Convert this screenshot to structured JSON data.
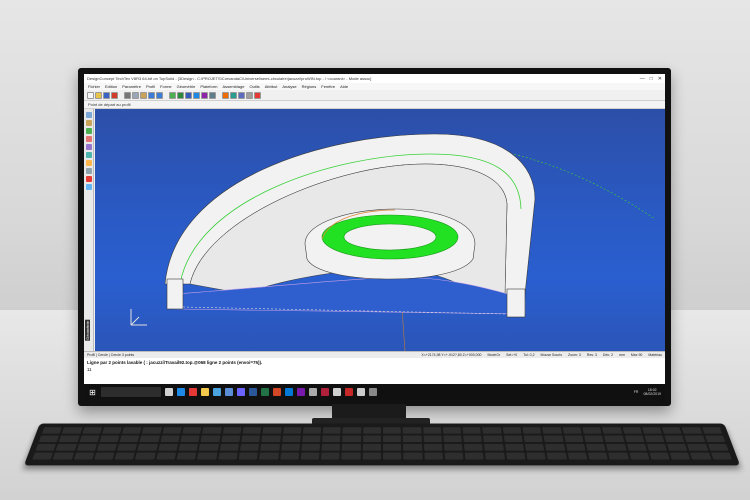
{
  "app": {
    "title": "DesignConcept TechTex V8R3 64-bit on TopSolid - [3Design - C:\\PROJETS\\CorvandaC\\Universel\\semi-circulaire\\jacuzzi\\proWIN.top - \\ <courant> - Mode assoc]",
    "window_controls": [
      "—",
      "□",
      "✕"
    ]
  },
  "menu": {
    "items": [
      "Fichier",
      "Edition",
      "Paramètre",
      "Profil",
      "Forme",
      "Géométrie",
      "Plateform",
      "Assemblage",
      "Outils",
      "Attribut",
      "Analyse",
      "Régions",
      "Fenêtre",
      "Aide"
    ]
  },
  "toolbar": {
    "buttons": [
      {
        "icon": "new-file-icon",
        "color": "#f7f7f7"
      },
      {
        "icon": "open-folder-icon",
        "color": "#e7c44a"
      },
      {
        "icon": "save-icon",
        "color": "#3b63c7"
      },
      {
        "icon": "delete-icon",
        "color": "#d23a2a"
      },
      {
        "icon": "cut-icon",
        "color": "#777777"
      },
      {
        "icon": "copy-icon",
        "color": "#9aa6b5"
      },
      {
        "icon": "paste-icon",
        "color": "#c9a35a"
      },
      {
        "icon": "undo-icon",
        "color": "#3d7bd8"
      },
      {
        "icon": "redo-icon",
        "color": "#3d7bd8"
      },
      {
        "icon": "zoom-icon",
        "color": "#4caf50"
      },
      {
        "icon": "rotate-icon",
        "color": "#2c8a3a"
      },
      {
        "icon": "view-icon",
        "color": "#355cb8"
      },
      {
        "icon": "render-icon",
        "color": "#1e88e5"
      },
      {
        "icon": "shade-icon",
        "color": "#8e24aa"
      },
      {
        "icon": "measure-icon",
        "color": "#607d8b"
      },
      {
        "icon": "layer-icon",
        "color": "#ef6c00"
      },
      {
        "icon": "pan-icon",
        "color": "#2a9d8f"
      },
      {
        "icon": "fit-icon",
        "color": "#5c6bc0"
      },
      {
        "icon": "grid-icon",
        "color": "#9e9e9e"
      },
      {
        "icon": "snap-icon",
        "color": "#e53935"
      }
    ]
  },
  "subbar": {
    "label": "Point de départ au profil"
  },
  "left_tools": [
    "#7aa6d8",
    "#c9a35a",
    "#4caf50",
    "#e57373",
    "#9575cd",
    "#4db6ac",
    "#ffb74d",
    "#90a4ae",
    "#e53935",
    "#64b5f6"
  ],
  "viewport": {
    "vertical_label": "Géométrie",
    "colors": {
      "background": "#2a59c2",
      "model": "#f2f2f2",
      "ring": "#22e022",
      "edge": "#3a3a3a",
      "green_line": "#38d038"
    }
  },
  "status": {
    "left": "Profil | Cercle | Cercle 3 points",
    "coords": "X=+2174,98 Y=+-912?,80 Z=+000,000",
    "mode": "ModeGr",
    "sel": "Sel=+0",
    "tol": "Tol: 0,2",
    "mouse": "Mouse Souris",
    "zoom": "Zoom: 3",
    "res": "Res: 3",
    "dec": "Déc: 2",
    "unit": "mm",
    "max": "Max 90",
    "mat": "Matériau"
  },
  "command": {
    "line1": "Ligne par 2 points lavable ( : jacuzzi\\Travail92.top.@068 ligne 2 points (envoi=75)).",
    "line2": "11"
  },
  "taskbar": {
    "apps": [
      {
        "icon": "task-view-icon",
        "color": "#d0d0d0"
      },
      {
        "icon": "edge-icon",
        "color": "#1e88e5"
      },
      {
        "icon": "chrome-icon",
        "color": "#e53935"
      },
      {
        "icon": "explorer-icon",
        "color": "#f2c94c"
      },
      {
        "icon": "store-icon",
        "color": "#4aa3df"
      },
      {
        "icon": "mail-icon",
        "color": "#5b8dd6"
      },
      {
        "icon": "teams-icon",
        "color": "#6c63ff"
      },
      {
        "icon": "word-icon",
        "color": "#2b579a"
      },
      {
        "icon": "excel-icon",
        "color": "#217346"
      },
      {
        "icon": "powerpoint-icon",
        "color": "#d24726"
      },
      {
        "icon": "outlook-icon",
        "color": "#0078d4"
      },
      {
        "icon": "onenote-icon",
        "color": "#7719aa"
      },
      {
        "icon": "photos-icon",
        "color": "#aaaaaa"
      },
      {
        "icon": "vpn-icon",
        "color": "#b0203a"
      },
      {
        "icon": "cad-icon",
        "color": "#d0d0d0"
      },
      {
        "icon": "cad2-icon",
        "color": "#c62828"
      },
      {
        "icon": "settings-icon",
        "color": "#cccccc"
      },
      {
        "icon": "app-icon",
        "color": "#888888"
      }
    ],
    "time": "18:02",
    "date": "08/02/2019",
    "tray_text": "FR"
  }
}
